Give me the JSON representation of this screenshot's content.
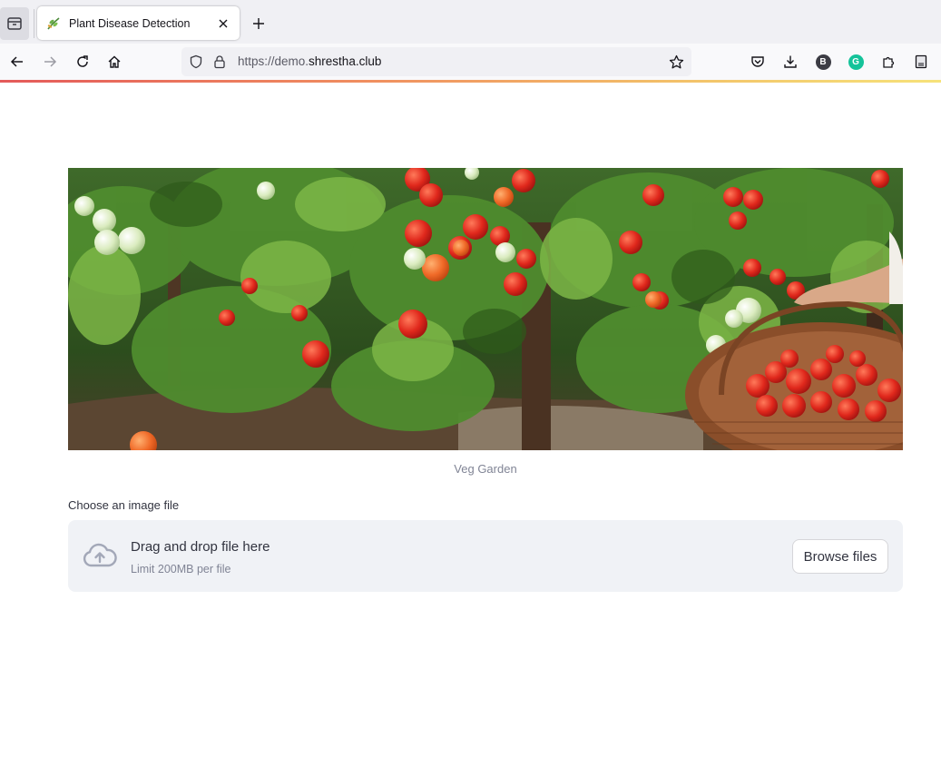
{
  "browser": {
    "tab_title": "Plant Disease Detection",
    "url_prefix": "https://demo.",
    "url_host": "shrestha.club",
    "extension_b_letter": "B",
    "extension_g_letter": "G",
    "icons": [
      "tab-list-icon",
      "leaf-favicon-icon",
      "close-icon",
      "plus-icon",
      "back-arrow-icon",
      "forward-arrow-icon",
      "reload-icon",
      "home-icon",
      "shield-icon",
      "lock-icon",
      "star-icon",
      "pocket-icon",
      "download-icon",
      "extensions-icon",
      "reader-icon"
    ]
  },
  "page": {
    "banner_caption": "Veg Garden",
    "uploader": {
      "label": "Choose an image file",
      "drop_title": "Drag and drop file here",
      "drop_limit": "Limit 200MB per file",
      "browse_label": "Browse files"
    }
  },
  "colors": {
    "accent_gradient_start": "#e45a5a",
    "accent_gradient_end": "#f6e27a",
    "dropzone_bg": "#f0f2f6",
    "grammarly_green": "#15c39a",
    "ext_b_bg": "#3c3c44"
  }
}
